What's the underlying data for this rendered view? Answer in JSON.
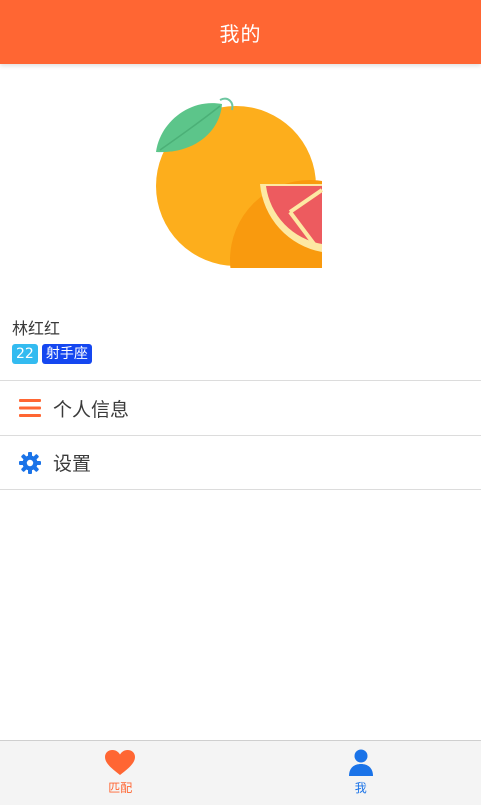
{
  "header": {
    "title": "我的"
  },
  "profile": {
    "name": "林红红",
    "age": "22",
    "zodiac": "射手座"
  },
  "menu": [
    {
      "label": "个人信息",
      "icon": "list-icon"
    },
    {
      "label": "设置",
      "icon": "gear-icon"
    }
  ],
  "tabbar": {
    "tabs": [
      {
        "label": "匹配",
        "icon": "heart-icon"
      },
      {
        "label": "我",
        "icon": "user-icon"
      }
    ]
  },
  "colors": {
    "accent": "#ff6633",
    "age_badge": "#33bbf0",
    "zodiac_badge": "#1547f0",
    "active_blue": "#1a73e8"
  }
}
